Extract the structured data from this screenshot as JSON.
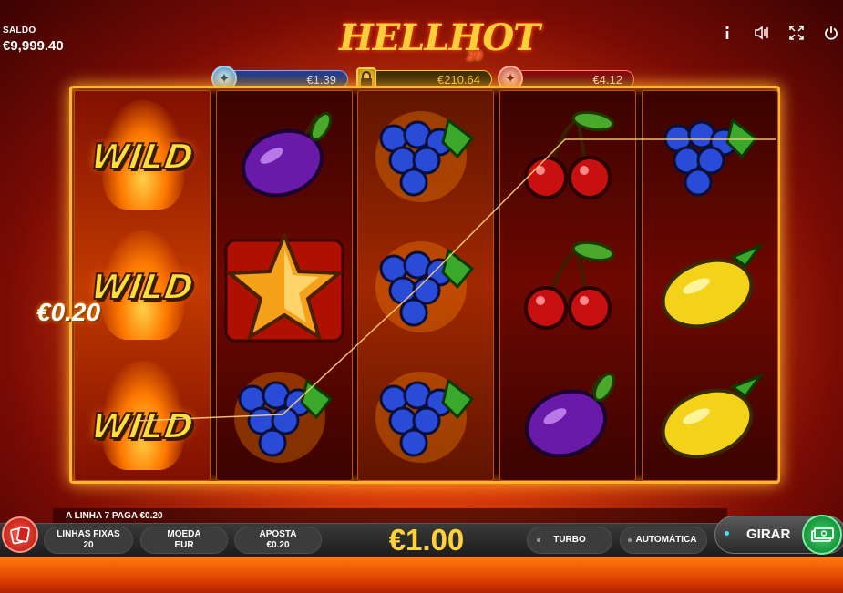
{
  "balance": {
    "label": "SALDO",
    "value": "€9,999.40"
  },
  "logo": {
    "title": "HELLHOT",
    "subtitle": "20"
  },
  "top_icons": [
    "info-icon",
    "sound-icon",
    "fullscreen-icon",
    "power-icon"
  ],
  "jackpots": {
    "blue": "€1.39",
    "gold": "€210.64",
    "red": "€4.12"
  },
  "reels": [
    [
      "WILD",
      "WILD",
      "WILD"
    ],
    [
      "plum",
      "star",
      "grapes"
    ],
    [
      "grapes",
      "grapes",
      "grapes"
    ],
    [
      "cherry",
      "cherry",
      "plum"
    ],
    [
      "grapes",
      "lemon",
      "lemon"
    ]
  ],
  "win": {
    "amount": "€0.20"
  },
  "message": "A LINHA 7 PAGA €0.20",
  "controls": {
    "lines_label": "LINHAS FIXAS",
    "lines_value": "20",
    "coin_label": "MOEDA",
    "coin_value": "EUR",
    "bet_label": "APOSTA",
    "bet_value": "€0.20",
    "total_bet": "€1.00",
    "turbo": "TURBO",
    "auto": "AUTOMÁTICA",
    "spin": "GIRAR"
  },
  "colors": {
    "accent_gold": "#ffd23a",
    "wild": "#ffdd3a",
    "spin_chip": "#1fa84a"
  }
}
